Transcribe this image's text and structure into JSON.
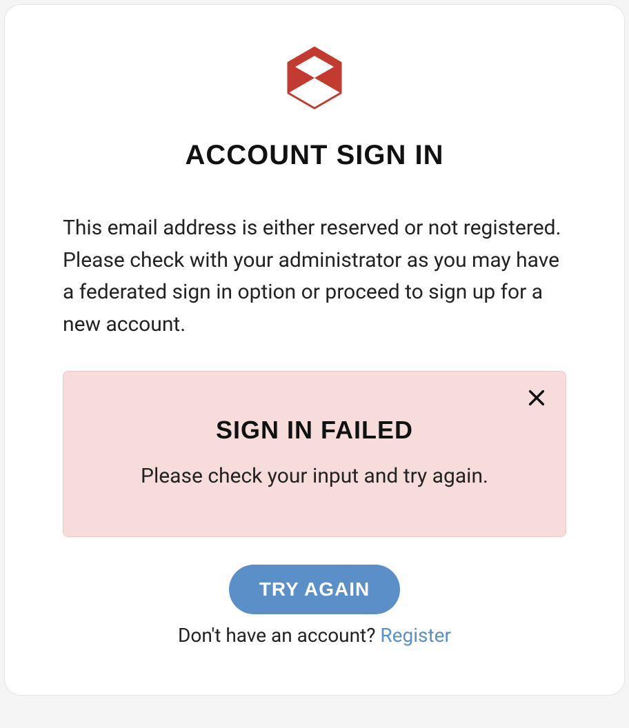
{
  "heading": "ACCOUNT SIGN IN",
  "message": "This email address is either reserved or not registered. Please check with your administrator as you may have a federated sign in option or proceed to sign up for a new account.",
  "alert": {
    "title": "SIGN IN FAILED",
    "body": "Please check your input and try again."
  },
  "actions": {
    "try_again": "TRY AGAIN",
    "footer_prompt": "Don't have an account? ",
    "register": "Register"
  },
  "colors": {
    "brand_red": "#c23b2e",
    "accent_blue": "#5a8fc7",
    "alert_bg": "#f7dcdc"
  }
}
